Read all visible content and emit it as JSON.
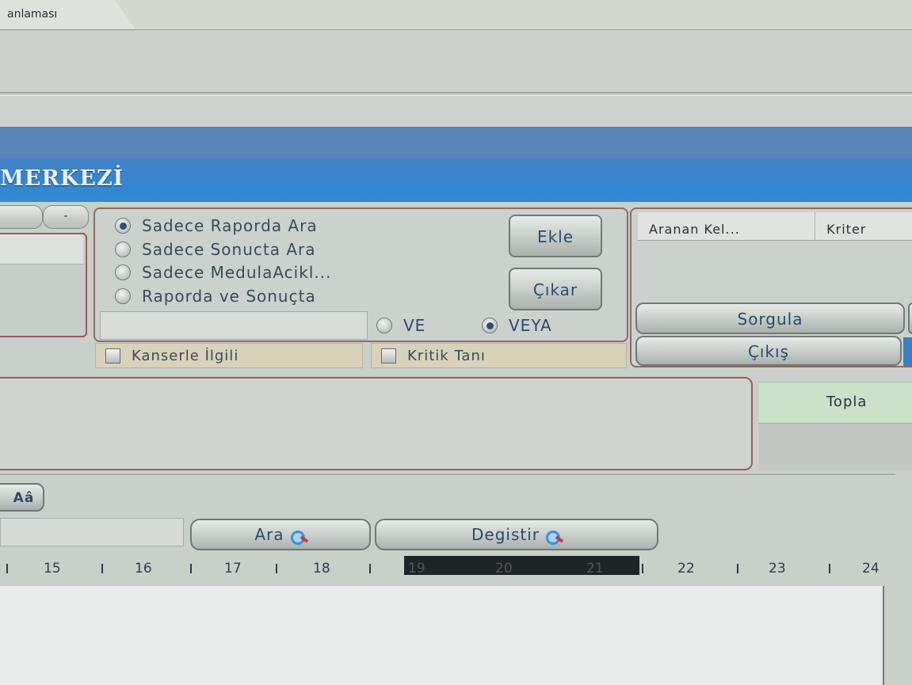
{
  "tab": {
    "label": "anlaması"
  },
  "header": {
    "title": "MERKEZİ"
  },
  "left_controls": {
    "minus_label": "-"
  },
  "search_scope": {
    "options": [
      {
        "label": "Sadece Raporda Ara",
        "selected": true
      },
      {
        "label": "Sadece Sonucta Ara",
        "selected": false
      },
      {
        "label": "Sadece MedulaAcikl...",
        "selected": false
      },
      {
        "label": "Raporda ve Sonuçta",
        "selected": false
      }
    ],
    "add_label": "Ekle",
    "remove_label": "Çıkar",
    "search_value": "",
    "logic": {
      "and_label": "VE",
      "or_label": "VEYA",
      "selected": "VEYA"
    }
  },
  "filters": {
    "cancer_label": "Kanserle İlgili",
    "cancer_checked": false,
    "critical_label": "Kritik Tanı",
    "critical_checked": false
  },
  "criteria_table": {
    "columns": [
      "Aranan Kel...",
      "Kriter"
    ]
  },
  "actions": {
    "query_label": "Sorgula",
    "exit_label": "Çıkış"
  },
  "summary": {
    "total_label": "Topla"
  },
  "editor_toolbar": {
    "case_button_label": "Aâ",
    "find_value": "",
    "find_label": "Ara",
    "replace_label": "Degistir"
  },
  "ruler": {
    "numbers": [
      "15",
      "16",
      "17",
      "18",
      "19",
      "20",
      "21",
      "22",
      "23",
      "24"
    ]
  },
  "colors": {
    "header_blue": "#2f8ad3",
    "panel_border": "#9a5a5a",
    "accent_text": "#2d4a6b"
  }
}
